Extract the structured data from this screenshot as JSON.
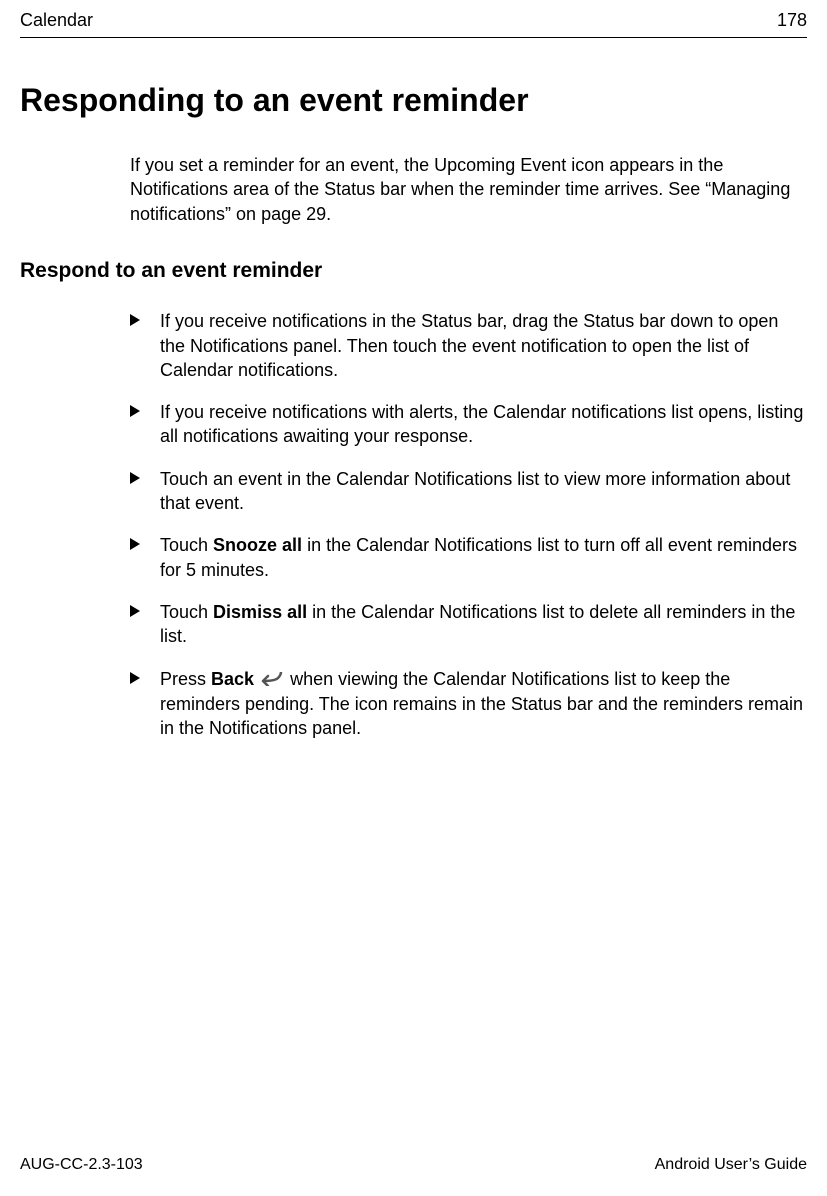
{
  "header": {
    "section": "Calendar",
    "page_number": "178"
  },
  "main": {
    "title": "Responding to an event reminder",
    "intro": "If you set a reminder for an event, the Upcoming Event icon appears in the Notifications area of the Status bar when the reminder time arrives. See “Managing notifications” on page 29.",
    "subheading": "Respond to an event reminder",
    "steps": [
      {
        "text": "If you receive notifications in the Status bar, drag the Status bar down to open the Notifications panel. Then touch the event notification to open the list of Calendar notifications."
      },
      {
        "text": "If you receive notifications with alerts, the Calendar notifications list opens, listing all notifications awaiting your response."
      },
      {
        "text": "Touch an event in the Calendar Notifications list to view more information about that event."
      },
      {
        "prefix": "Touch ",
        "bold": "Snooze all",
        "suffix": " in the Calendar Notifications list to turn off all event reminders for 5 minutes."
      },
      {
        "prefix": "Touch ",
        "bold": "Dismiss all",
        "suffix": " in the Calendar Notifications list to delete all reminders in the list."
      },
      {
        "prefix": "Press ",
        "bold": "Back",
        "icon": "back-icon",
        "suffix": " when viewing the Calendar Notifications list to keep the reminders pending. The icon remains in the Status bar and the reminders remain in the Notifications panel."
      }
    ]
  },
  "footer": {
    "doc_id": "AUG-CC-2.3-103",
    "guide_name": "Android User’s Guide"
  }
}
